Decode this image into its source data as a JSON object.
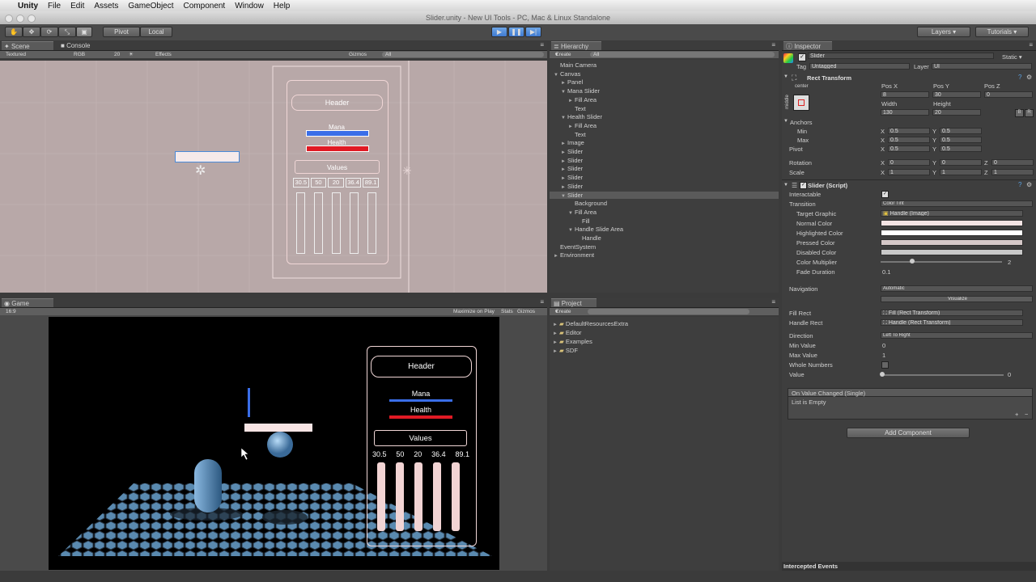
{
  "menubar": {
    "app": "Unity",
    "items": [
      "File",
      "Edit",
      "Assets",
      "GameObject",
      "Component",
      "Window",
      "Help"
    ]
  },
  "window_title": "Slider.unity - New UI Tools - PC, Mac & Linux Standalone",
  "toolbar": {
    "pivot": "Pivot",
    "local": "Local",
    "layers": "Layers",
    "layout": "Tutorials"
  },
  "scene": {
    "tabs": [
      "Scene",
      "Console"
    ],
    "sub": {
      "mode": "Textured",
      "color": "RGB",
      "size": "20",
      "effects": "Effects",
      "gizmos": "Gizmos",
      "search": "All"
    },
    "canvas_ui": {
      "header": "Header",
      "mana": "Mana",
      "health": "Health",
      "values": "Values",
      "numbers": [
        "30.5",
        "50",
        "20",
        "36.4",
        "89.1"
      ]
    }
  },
  "game": {
    "tab": "Game",
    "sub": {
      "aspect": "16:9",
      "maximize": "Maximize on Play",
      "stats": "Stats",
      "gizmos": "Gizmos"
    },
    "ui": {
      "header": "Header",
      "mana": "Mana",
      "health": "Health",
      "values": "Values",
      "numbers": [
        "30.5",
        "50",
        "20",
        "36.4",
        "89.1"
      ]
    }
  },
  "hierarchy": {
    "tab": "Hierarchy",
    "create": "Create",
    "search": "All",
    "items": [
      {
        "label": "Main Camera",
        "indent": 0,
        "arrow": ""
      },
      {
        "label": "Canvas",
        "indent": 0,
        "arrow": "▼"
      },
      {
        "label": "Panel",
        "indent": 1,
        "arrow": "►"
      },
      {
        "label": "Mana Slider",
        "indent": 1,
        "arrow": "▼"
      },
      {
        "label": "Fill Area",
        "indent": 2,
        "arrow": "►"
      },
      {
        "label": "Text",
        "indent": 2,
        "arrow": ""
      },
      {
        "label": "Health Slider",
        "indent": 1,
        "arrow": "▼"
      },
      {
        "label": "Fill Area",
        "indent": 2,
        "arrow": "►"
      },
      {
        "label": "Text",
        "indent": 2,
        "arrow": ""
      },
      {
        "label": "Image",
        "indent": 1,
        "arrow": "►"
      },
      {
        "label": "Slider",
        "indent": 1,
        "arrow": "►"
      },
      {
        "label": "Slider",
        "indent": 1,
        "arrow": "►"
      },
      {
        "label": "Slider",
        "indent": 1,
        "arrow": "►"
      },
      {
        "label": "Slider",
        "indent": 1,
        "arrow": "►"
      },
      {
        "label": "Slider",
        "indent": 1,
        "arrow": "►"
      },
      {
        "label": "Slider",
        "indent": 1,
        "arrow": "▼",
        "selected": true
      },
      {
        "label": "Background",
        "indent": 2,
        "arrow": ""
      },
      {
        "label": "Fill Area",
        "indent": 2,
        "arrow": "▼"
      },
      {
        "label": "Fill",
        "indent": 3,
        "arrow": ""
      },
      {
        "label": "Handle Slide Area",
        "indent": 2,
        "arrow": "▼"
      },
      {
        "label": "Handle",
        "indent": 3,
        "arrow": ""
      },
      {
        "label": "EventSystem",
        "indent": 0,
        "arrow": ""
      },
      {
        "label": "Environment",
        "indent": 0,
        "arrow": "►"
      }
    ]
  },
  "project": {
    "tab": "Project",
    "create": "Create",
    "folders": [
      "DefaultResourcesExtra",
      "Editor",
      "Examples",
      "SDF"
    ]
  },
  "inspector": {
    "tab": "Inspector",
    "object_name": "Slider",
    "static": "Static",
    "tag_label": "Tag",
    "tag_value": "Untagged",
    "layer_label": "Layer",
    "layer_value": "UI",
    "rect_transform": {
      "title": "Rect Transform",
      "anchor_h": "center",
      "anchor_v": "middle",
      "pos_x_label": "Pos X",
      "pos_y_label": "Pos Y",
      "pos_z_label": "Pos Z",
      "pos_x": "8",
      "pos_y": "30",
      "pos_z": "0",
      "width_label": "Width",
      "height_label": "Height",
      "width": "130",
      "height": "20",
      "anchors": "Anchors",
      "min": "Min",
      "max": "Max",
      "min_x": "0.5",
      "min_y": "0.5",
      "max_x": "0.5",
      "max_y": "0.5",
      "pivot": "Pivot",
      "pivot_x": "0.5",
      "pivot_y": "0.5",
      "rotation": "Rotation",
      "rot_x": "0",
      "rot_y": "0",
      "rot_z": "0",
      "scale": "Scale",
      "scale_x": "1",
      "scale_y": "1",
      "scale_z": "1"
    },
    "slider_script": {
      "title": "Slider (Script)",
      "interactable": "Interactable",
      "transition": "Transition",
      "transition_value": "Color Tint",
      "target_graphic": "Target Graphic",
      "target_graphic_value": "Handle (Image)",
      "normal_color": "Normal Color",
      "highlighted_color": "Highlighted Color",
      "pressed_color": "Pressed Color",
      "disabled_color": "Disabled Color",
      "color_multiplier": "Color Multiplier",
      "color_multiplier_value": "2",
      "fade_duration": "Fade Duration",
      "fade_duration_value": "0.1",
      "navigation": "Navigation",
      "navigation_value": "Automatic",
      "visualize": "Visualize",
      "fill_rect": "Fill Rect",
      "fill_rect_value": "Fill (Rect Transform)",
      "handle_rect": "Handle Rect",
      "handle_rect_value": "Handle (Rect Transform)",
      "direction": "Direction",
      "direction_value": "Left To Right",
      "min_value": "Min Value",
      "min_value_value": "0",
      "max_value": "Max Value",
      "max_value_value": "1",
      "whole_numbers": "Whole Numbers",
      "value": "Value",
      "value_value": "0",
      "value_fraction": 0
    },
    "event": {
      "title": "On Value Changed (Single)",
      "empty": "List is Empty"
    },
    "add_component": "Add Component",
    "intercepted": "Intercepted Events"
  },
  "colors": {
    "accent": "#3f7ad0",
    "mana": "#3a6ee8",
    "health": "#e01a24",
    "selection": "#5a6a8a"
  }
}
